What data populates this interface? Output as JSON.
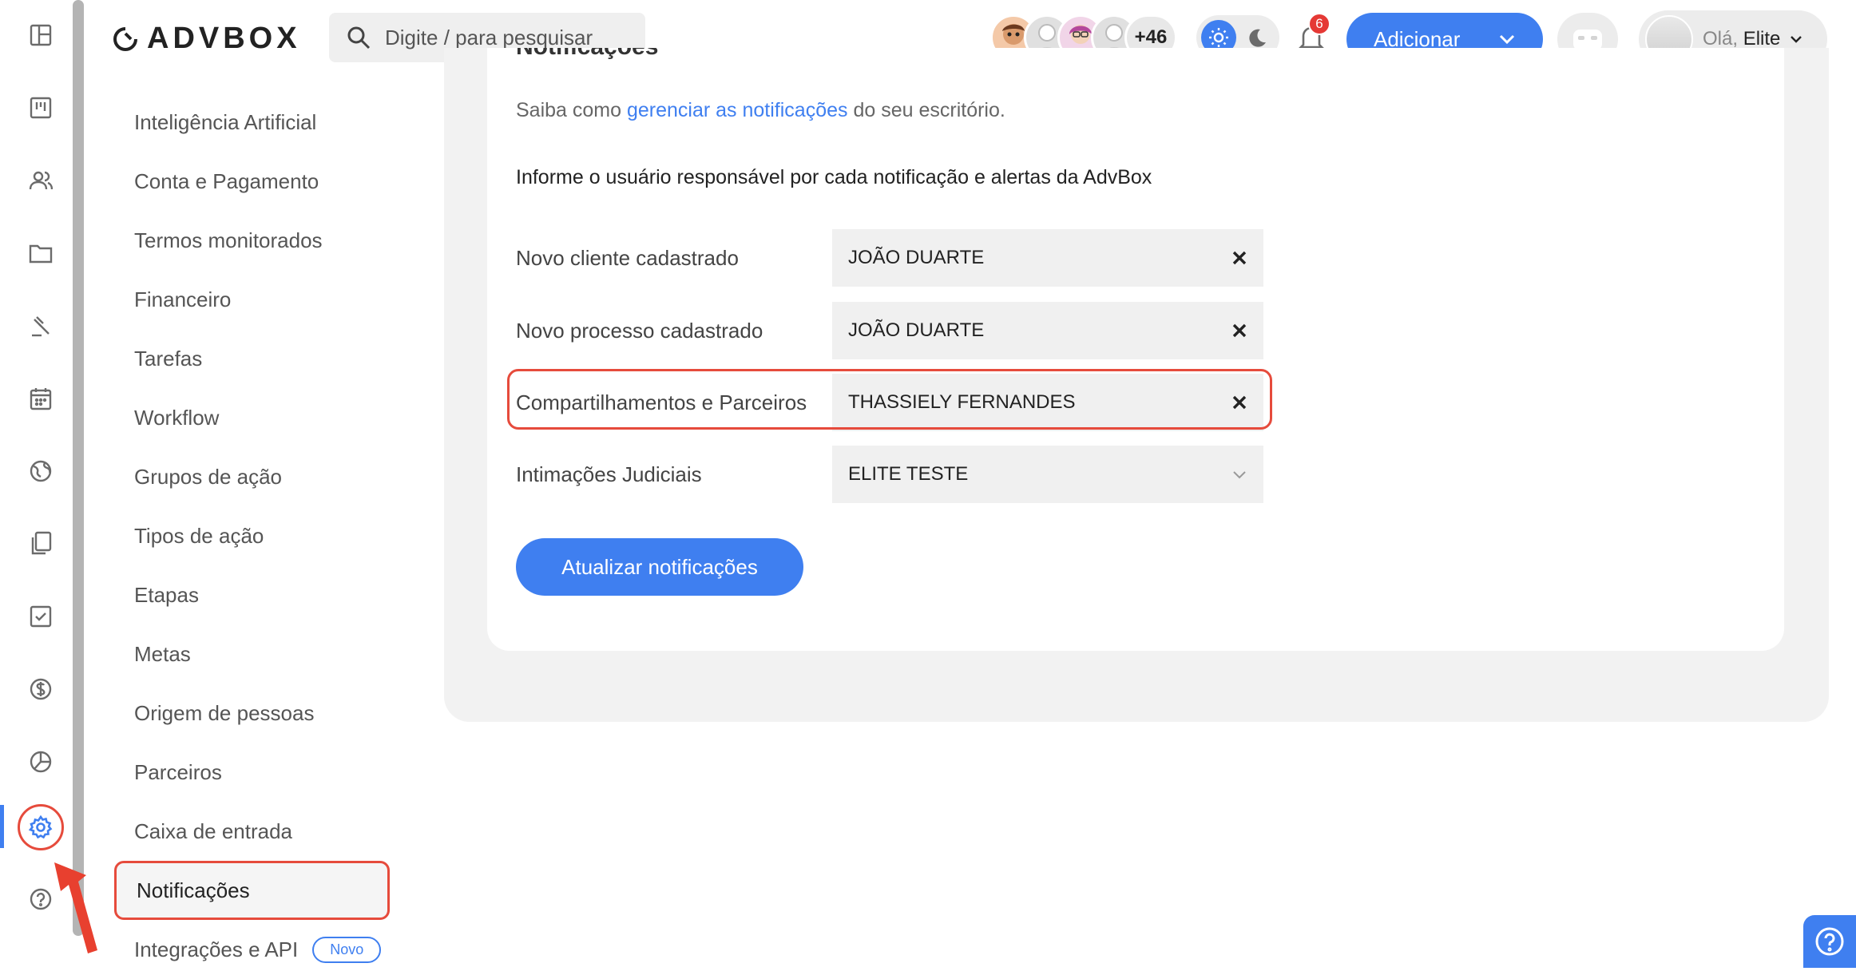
{
  "app": {
    "logo_text": "ADVBOX"
  },
  "search": {
    "placeholder": "Digite / para pesquisar"
  },
  "header": {
    "avatars_more": "+46",
    "notifications_count": "6",
    "add_button_label": "Adicionar",
    "greeting_prefix": "Olá,",
    "user_name": "Elite"
  },
  "rail": {
    "icons": [
      "dashboard-icon",
      "board-icon",
      "people-icon",
      "folder-icon",
      "gavel-icon",
      "calendar-icon",
      "globe-icon",
      "documents-icon",
      "checkbox-icon",
      "dollar-icon",
      "pie-chart-icon",
      "settings-icon",
      "help-icon"
    ],
    "active": "settings-icon"
  },
  "settings_menu": {
    "items": [
      {
        "label": "Inteligência Artificial"
      },
      {
        "label": "Conta e Pagamento"
      },
      {
        "label": "Termos monitorados"
      },
      {
        "label": "Financeiro"
      },
      {
        "label": "Tarefas"
      },
      {
        "label": "Workflow"
      },
      {
        "label": "Grupos de ação"
      },
      {
        "label": "Tipos de ação"
      },
      {
        "label": "Etapas"
      },
      {
        "label": "Metas"
      },
      {
        "label": "Origem de pessoas"
      },
      {
        "label": "Parceiros"
      },
      {
        "label": "Caixa de entrada"
      },
      {
        "label": "Notificações"
      },
      {
        "label": "Integrações e API",
        "badge": "Novo"
      }
    ],
    "active": "Notificações"
  },
  "notifications_page": {
    "title": "Notificações",
    "help_prefix": "Saiba como ",
    "help_link": "gerenciar as notificações",
    "help_suffix": " do seu escritório.",
    "instructions": "Informe o usuário responsável por cada notificação e alertas da AdvBox",
    "rows": [
      {
        "label": "Novo cliente cadastrado",
        "value": "JOÃO DUARTE",
        "control": "clear"
      },
      {
        "label": "Novo processo cadastrado",
        "value": "JOÃO DUARTE",
        "control": "clear"
      },
      {
        "label": "Compartilhamentos e Parceiros",
        "value": "THASSIELY FERNANDES",
        "control": "clear"
      },
      {
        "label": "Intimações Judiciais",
        "value": "ELITE TESTE",
        "control": "dropdown"
      }
    ],
    "submit_label": "Atualizar notificações"
  },
  "colors": {
    "accent": "#3f7ff0",
    "highlight": "#e64b3c",
    "panel": "#f2f2f2"
  }
}
